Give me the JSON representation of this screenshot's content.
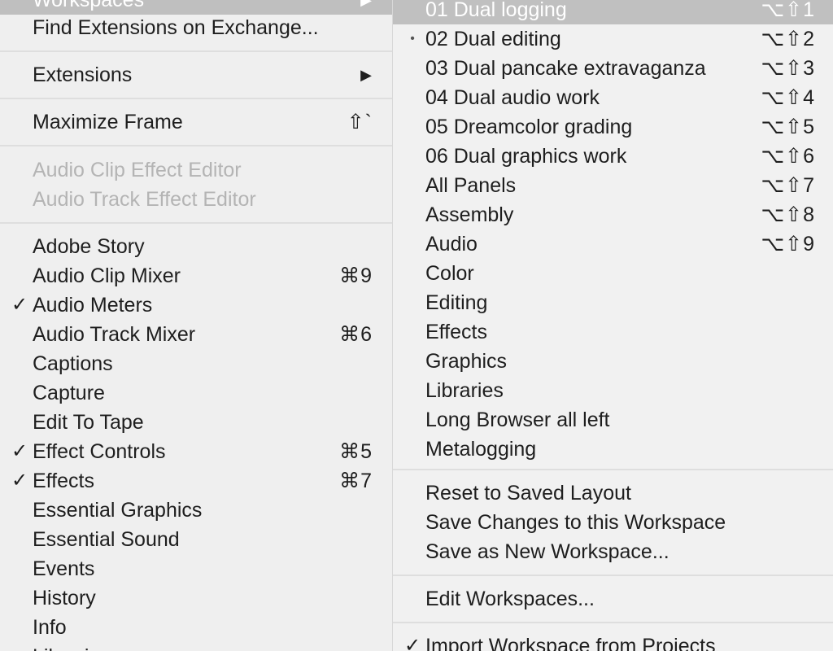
{
  "left_menu": {
    "workspaces": {
      "label": "Workspaces",
      "arrow": "▶"
    },
    "find_extensions": {
      "label": "Find Extensions on Exchange..."
    },
    "extensions": {
      "label": "Extensions",
      "arrow": "▶"
    },
    "maximize_frame": {
      "label": "Maximize Frame",
      "shortcut": "⇧`"
    },
    "audio_clip_effect_editor": {
      "label": "Audio Clip Effect Editor"
    },
    "audio_track_effect_editor": {
      "label": "Audio Track Effect Editor"
    },
    "panels": [
      {
        "label": "Adobe Story",
        "shortcut": "",
        "check": ""
      },
      {
        "label": "Audio Clip Mixer",
        "shortcut": "⌘9",
        "check": ""
      },
      {
        "label": "Audio Meters",
        "shortcut": "",
        "check": "✓"
      },
      {
        "label": "Audio Track Mixer",
        "shortcut": "⌘6",
        "check": ""
      },
      {
        "label": "Captions",
        "shortcut": "",
        "check": ""
      },
      {
        "label": "Capture",
        "shortcut": "",
        "check": ""
      },
      {
        "label": "Edit To Tape",
        "shortcut": "",
        "check": ""
      },
      {
        "label": "Effect Controls",
        "shortcut": "⌘5",
        "check": "✓"
      },
      {
        "label": "Effects",
        "shortcut": "⌘7",
        "check": "✓"
      },
      {
        "label": "Essential Graphics",
        "shortcut": "",
        "check": ""
      },
      {
        "label": "Essential Sound",
        "shortcut": "",
        "check": ""
      },
      {
        "label": "Events",
        "shortcut": "",
        "check": ""
      },
      {
        "label": "History",
        "shortcut": "",
        "check": ""
      },
      {
        "label": "Info",
        "shortcut": "",
        "check": ""
      },
      {
        "label": "Libraries",
        "shortcut": "",
        "check": ""
      }
    ]
  },
  "right_menu": {
    "workspaces": [
      {
        "label": "01 Dual logging",
        "shortcut": "⌥⇧1",
        "mark": ""
      },
      {
        "label": "02 Dual editing",
        "shortcut": "⌥⇧2",
        "mark": "•"
      },
      {
        "label": "03 Dual pancake extravaganza",
        "shortcut": "⌥⇧3",
        "mark": ""
      },
      {
        "label": "04 Dual audio work",
        "shortcut": "⌥⇧4",
        "mark": ""
      },
      {
        "label": "05 Dreamcolor grading",
        "shortcut": "⌥⇧5",
        "mark": ""
      },
      {
        "label": "06 Dual graphics work",
        "shortcut": "⌥⇧6",
        "mark": ""
      },
      {
        "label": "All Panels",
        "shortcut": "⌥⇧7",
        "mark": ""
      },
      {
        "label": "Assembly",
        "shortcut": "⌥⇧8",
        "mark": ""
      },
      {
        "label": "Audio",
        "shortcut": "⌥⇧9",
        "mark": ""
      },
      {
        "label": "Color",
        "shortcut": "",
        "mark": ""
      },
      {
        "label": "Editing",
        "shortcut": "",
        "mark": ""
      },
      {
        "label": "Effects",
        "shortcut": "",
        "mark": ""
      },
      {
        "label": "Graphics",
        "shortcut": "",
        "mark": ""
      },
      {
        "label": "Libraries",
        "shortcut": "",
        "mark": ""
      },
      {
        "label": "Long Browser all left",
        "shortcut": "",
        "mark": ""
      },
      {
        "label": "Metalogging",
        "shortcut": "",
        "mark": ""
      }
    ],
    "reset_layout": {
      "label": "Reset to Saved Layout"
    },
    "save_changes": {
      "label": "Save Changes to this Workspace"
    },
    "save_new": {
      "label": "Save as New Workspace..."
    },
    "edit_workspaces": {
      "label": "Edit Workspaces..."
    },
    "import_workspace": {
      "label": "Import Workspace from Projects",
      "check": "✓"
    }
  }
}
